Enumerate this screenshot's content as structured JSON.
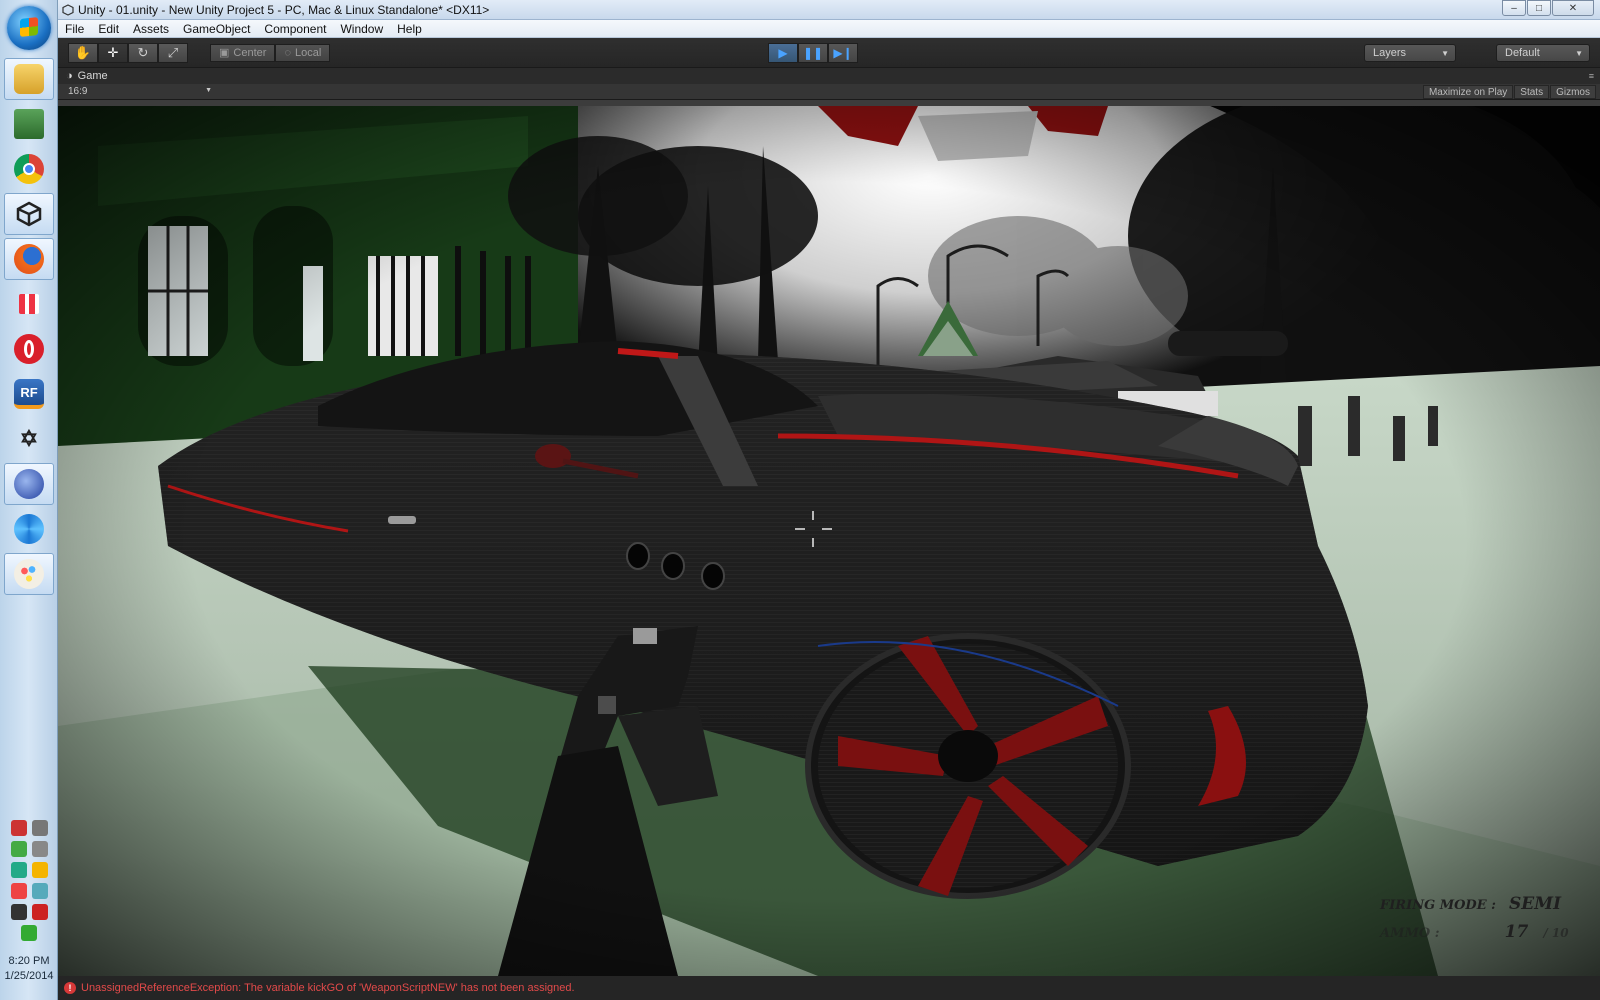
{
  "window": {
    "title": "Unity - 01.unity - New Unity Project 5 - PC, Mac & Linux Standalone* <DX11>",
    "min": "–",
    "max": "□",
    "close": "✕"
  },
  "menu": [
    "File",
    "Edit",
    "Assets",
    "GameObject",
    "Component",
    "Window",
    "Help"
  ],
  "toolbar": {
    "pivot_center": "Center",
    "pivot_local": "Local",
    "layers_label": "Layers",
    "layout_label": "Default"
  },
  "game_panel": {
    "tab_label": "Game",
    "aspect": "16:9",
    "maximize_on_play": "Maximize on Play",
    "stats": "Stats",
    "gizmos": "Gizmos"
  },
  "hud": {
    "firing_mode_label": "FIRING MODE :",
    "firing_mode_value": "SEMI",
    "ammo_label": "AMMO :",
    "ammo_value": "17",
    "ammo_total": "/ 10"
  },
  "console": {
    "error_text": "UnassignedReferenceException: The variable kickGO of 'WeaponScriptNEW' has not been assigned."
  },
  "taskbar": {
    "apps": [
      "file-explorer",
      "system-monitor",
      "chrome",
      "unity",
      "firefox",
      "app-grid",
      "opera",
      "rf-app",
      "zbrush",
      "cinema4d",
      "aperture",
      "paint"
    ],
    "clock_time": "8:20 PM",
    "clock_date": "1/25/2014"
  },
  "colors": {
    "unity_dark": "#3c3c3c",
    "play_active": "#4a6e96",
    "error_red": "#e24a4a"
  }
}
